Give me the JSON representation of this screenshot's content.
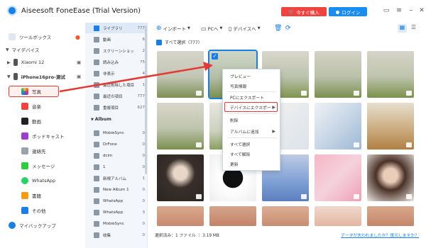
{
  "app": {
    "title": "Aiseesoft FoneEase (Trial Version)",
    "buy_label": "今すぐ購入",
    "login_label": "ログイン"
  },
  "sidebar": {
    "toolbox_label": "ツールボックス",
    "my_devices_label": "マイデバイス",
    "device1_label": "Xiaomi 12",
    "device2_label": "iPhone16pro-测试",
    "items": [
      {
        "label": "写真",
        "icon": "photos-icon"
      },
      {
        "label": "音楽",
        "icon": "music-icon"
      },
      {
        "label": "動画",
        "icon": "video-icon"
      },
      {
        "label": "ポッドキャスト",
        "icon": "podcast-icon"
      },
      {
        "label": "連絡先",
        "icon": "contacts-icon"
      },
      {
        "label": "メッセージ",
        "icon": "messages-icon"
      },
      {
        "label": "WhatsApp",
        "icon": "whatsapp-icon"
      },
      {
        "label": "書籍",
        "icon": "books-icon"
      },
      {
        "label": "その他",
        "icon": "other-icon"
      }
    ],
    "backup_label": "マイバックアップ"
  },
  "categories": [
    {
      "label": "ライブラリ",
      "count": "777"
    },
    {
      "label": "動画",
      "count": "6"
    },
    {
      "label": "スクリーンショット",
      "count": "2"
    },
    {
      "label": "読み込み",
      "count": "75"
    },
    {
      "label": "非表示",
      "count": "4"
    },
    {
      "label": "最近削除した項目",
      "count": "1"
    },
    {
      "label": "最近の項目",
      "count": "777"
    },
    {
      "label": "重複項目",
      "count": "627"
    }
  ],
  "album_header": "Album",
  "albums": [
    {
      "label": "MobieSync",
      "count": "0"
    },
    {
      "label": "DrFone",
      "count": "0"
    },
    {
      "label": "dcim",
      "count": "0"
    },
    {
      "label": "1",
      "count": "0"
    },
    {
      "label": "新規アルバム",
      "count": "1"
    },
    {
      "label": "New Album 1",
      "count": "0"
    },
    {
      "label": "WhatsApp",
      "count": "0"
    },
    {
      "label": "WhatsApp",
      "count": "3"
    },
    {
      "label": "MobieSync",
      "count": "0"
    },
    {
      "label": "收集",
      "count": "0"
    }
  ],
  "toolbar": {
    "import_label": "インポート",
    "pc_label": "PCへ",
    "device_label": "デバイスへ"
  },
  "select_all_label": "すべて選択（777）",
  "context_menu": {
    "items": [
      "プレビュー",
      "写真情報",
      "PCにエクスポート",
      "デバイスにエクスポート",
      "削除",
      "アルバムに追加",
      "すべて選択",
      "すべて解除",
      "更新"
    ]
  },
  "status": {
    "left": "選択済み：1 ファイル ｜ 3.19 MB",
    "right": "データが失われましたか？復元しますか？"
  },
  "colors": {
    "accent": "#1a7fe0",
    "buy": "#f0433e",
    "highlight": "#e53935"
  }
}
